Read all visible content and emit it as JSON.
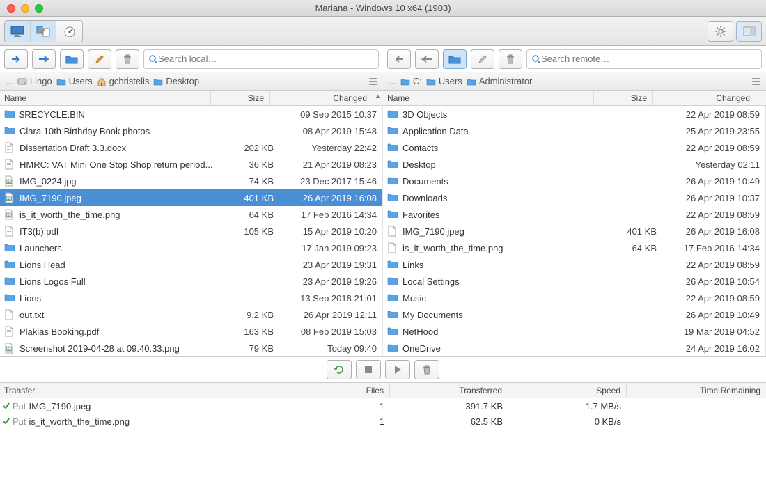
{
  "window": {
    "title": "Mariana - Windows 10 x64 (1903)"
  },
  "local": {
    "search_placeholder": "Search local…",
    "breadcrumb": [
      "...",
      "Lingo",
      "Users",
      "gchristelis",
      "Desktop"
    ],
    "columns": {
      "name": "Name",
      "size": "Size",
      "changed": "Changed"
    },
    "items": [
      {
        "icon": "folder",
        "name": "$RECYCLE.BIN",
        "size": "",
        "changed": "09 Sep 2015 10:37"
      },
      {
        "icon": "folder",
        "name": "Clara 10th Birthday Book photos",
        "size": "",
        "changed": "08 Apr 2019 15:48"
      },
      {
        "icon": "doc",
        "name": "Dissertation Draft 3.3.docx",
        "size": "202 KB",
        "changed": "Yesterday 22:42"
      },
      {
        "icon": "doc",
        "name": "HMRC: VAT Mini One Stop Shop return period...",
        "size": "36 KB",
        "changed": "21 Apr 2019 08:23"
      },
      {
        "icon": "image",
        "name": "IMG_0224.jpg",
        "size": "74 KB",
        "changed": "23 Dec 2017 15:46"
      },
      {
        "icon": "image",
        "name": "IMG_7190.jpeg",
        "size": "401 KB",
        "changed": "26 Apr 2019 16:08",
        "selected": true
      },
      {
        "icon": "image",
        "name": "is_it_worth_the_time.png",
        "size": "64 KB",
        "changed": "17 Feb 2016 14:34"
      },
      {
        "icon": "doc",
        "name": "IT3(b).pdf",
        "size": "105 KB",
        "changed": "15 Apr 2019 10:20"
      },
      {
        "icon": "folder",
        "name": "Launchers",
        "size": "",
        "changed": "17 Jan 2019 09:23"
      },
      {
        "icon": "folder",
        "name": "Lions Head",
        "size": "",
        "changed": "23 Apr 2019 19:31"
      },
      {
        "icon": "folder",
        "name": "Lions Logos Full",
        "size": "",
        "changed": "23 Apr 2019 19:26"
      },
      {
        "icon": "folder",
        "name": "Lions",
        "size": "",
        "changed": "13 Sep 2018 21:01"
      },
      {
        "icon": "file",
        "name": "out.txt",
        "size": "9.2 KB",
        "changed": "26 Apr 2019 12:11"
      },
      {
        "icon": "doc",
        "name": "Plakias Booking.pdf",
        "size": "163 KB",
        "changed": "08 Feb 2019 15:03"
      },
      {
        "icon": "image",
        "name": "Screenshot 2019-04-28 at 09.40.33.png",
        "size": "79 KB",
        "changed": "Today 09:40"
      }
    ]
  },
  "remote": {
    "search_placeholder": "Search remote…",
    "breadcrumb": [
      "...",
      "C:",
      "Users",
      "Administrator"
    ],
    "columns": {
      "name": "Name",
      "size": "Size",
      "changed": "Changed"
    },
    "items": [
      {
        "icon": "folder",
        "name": "3D Objects",
        "size": "",
        "changed": "22 Apr 2019 08:59"
      },
      {
        "icon": "folder",
        "name": "Application Data",
        "size": "",
        "changed": "25 Apr 2019 23:55"
      },
      {
        "icon": "folder",
        "name": "Contacts",
        "size": "",
        "changed": "22 Apr 2019 08:59"
      },
      {
        "icon": "folder",
        "name": "Desktop",
        "size": "",
        "changed": "Yesterday 02:11"
      },
      {
        "icon": "folder",
        "name": "Documents",
        "size": "",
        "changed": "26 Apr 2019 10:49"
      },
      {
        "icon": "folder",
        "name": "Downloads",
        "size": "",
        "changed": "26 Apr 2019 10:37"
      },
      {
        "icon": "folder",
        "name": "Favorites",
        "size": "",
        "changed": "22 Apr 2019 08:59"
      },
      {
        "icon": "file",
        "name": "IMG_7190.jpeg",
        "size": "401 KB",
        "changed": "26 Apr 2019 16:08"
      },
      {
        "icon": "file",
        "name": "is_it_worth_the_time.png",
        "size": "64 KB",
        "changed": "17 Feb 2016 14:34"
      },
      {
        "icon": "folder",
        "name": "Links",
        "size": "",
        "changed": "22 Apr 2019 08:59"
      },
      {
        "icon": "folder",
        "name": "Local Settings",
        "size": "",
        "changed": "26 Apr 2019 10:54"
      },
      {
        "icon": "folder",
        "name": "Music",
        "size": "",
        "changed": "22 Apr 2019 08:59"
      },
      {
        "icon": "folder",
        "name": "My Documents",
        "size": "",
        "changed": "26 Apr 2019 10:49"
      },
      {
        "icon": "folder",
        "name": "NetHood",
        "size": "",
        "changed": "19 Mar 2019 04:52"
      },
      {
        "icon": "folder",
        "name": "OneDrive",
        "size": "",
        "changed": "24 Apr 2019 16:02"
      }
    ]
  },
  "transfers": {
    "columns": {
      "transfer": "Transfer",
      "files": "Files",
      "transferred": "Transferred",
      "speed": "Speed",
      "remaining": "Time Remaining"
    },
    "rows": [
      {
        "status": "done",
        "action": "Put",
        "name": "IMG_7190.jpeg",
        "files": "1",
        "transferred": "391.7 KB",
        "speed": "1.7 MB/s",
        "remaining": ""
      },
      {
        "status": "done",
        "action": "Put",
        "name": "is_it_worth_the_time.png",
        "files": "1",
        "transferred": "62.5 KB",
        "speed": "0 KB/s",
        "remaining": ""
      }
    ]
  }
}
